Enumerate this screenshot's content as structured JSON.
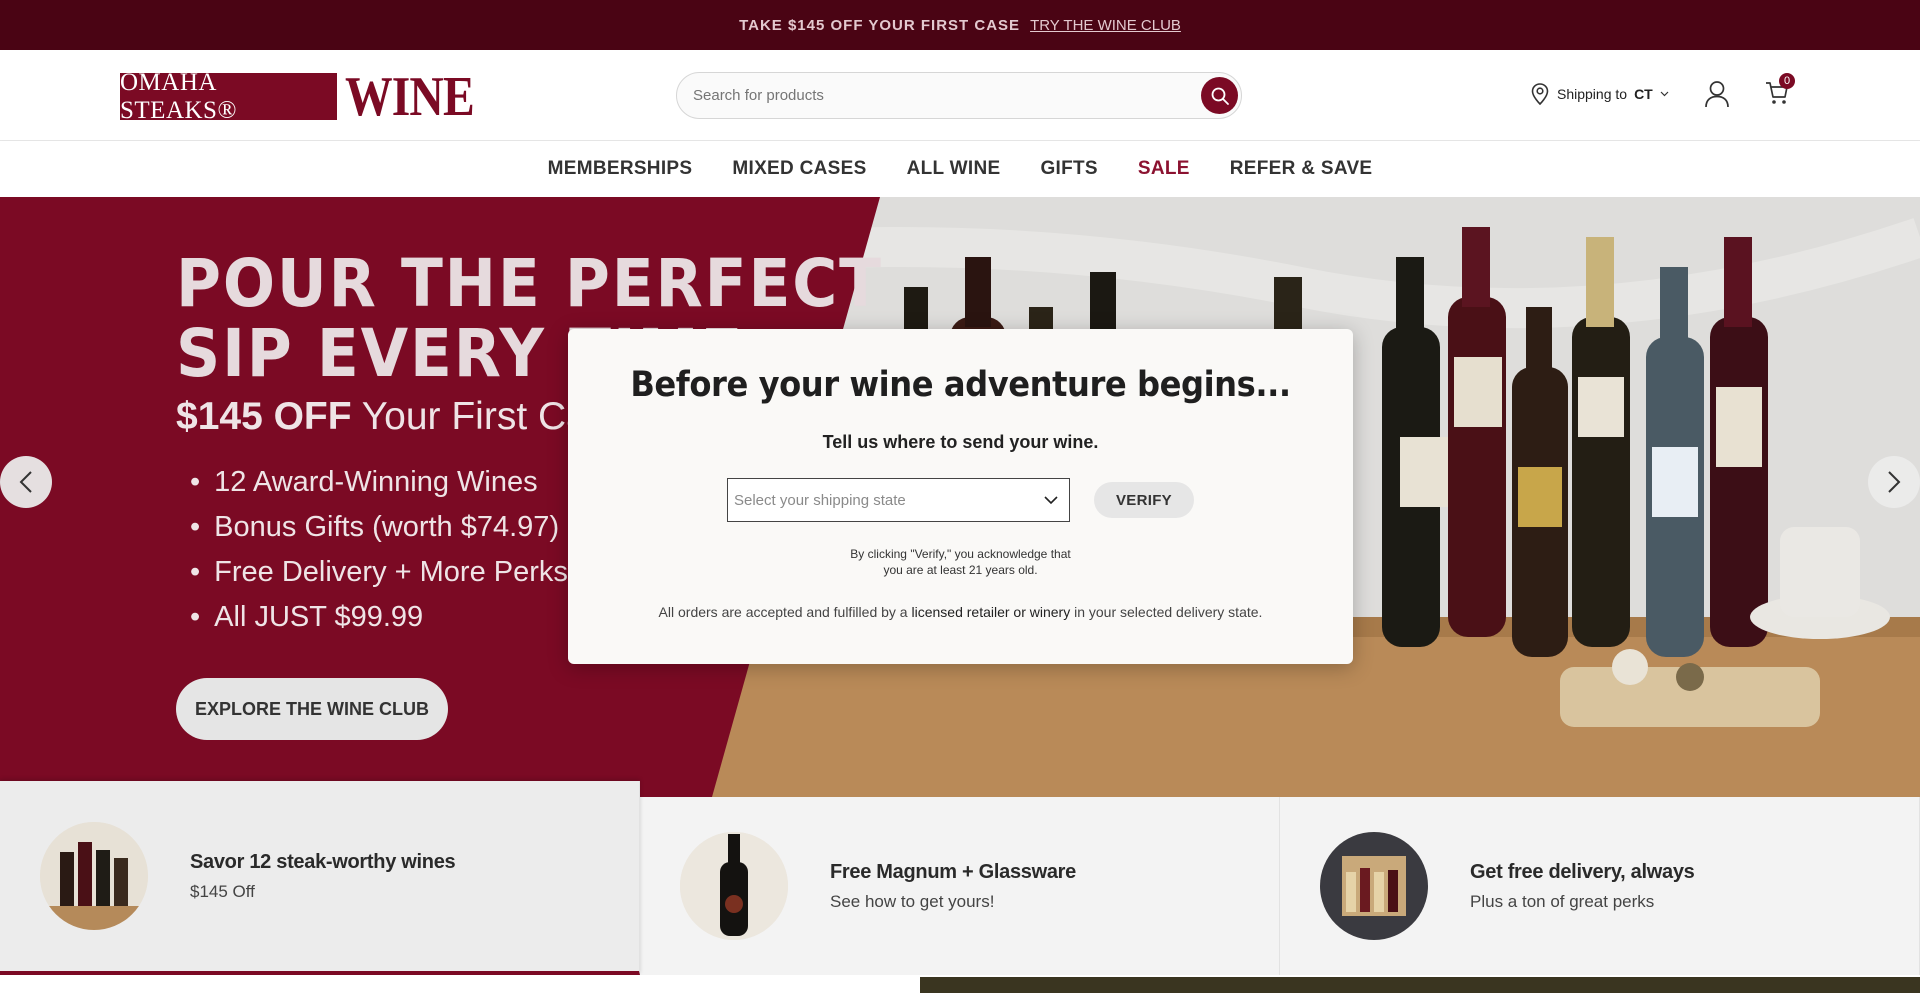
{
  "promo": {
    "text": "TAKE $145 OFF YOUR FIRST CASE",
    "link": "TRY THE WINE CLUB"
  },
  "header": {
    "logo_brand": "OMAHA STEAKS®",
    "logo_wine": "WINE",
    "search_placeholder": "Search for products",
    "shipping_label": "Shipping to",
    "shipping_state": "CT",
    "cart_count": "0"
  },
  "nav": {
    "items": [
      "MEMBERSHIPS",
      "MIXED CASES",
      "ALL WINE",
      "GIFTS",
      "SALE",
      "REFER & SAVE"
    ]
  },
  "hero": {
    "title_line1": "POUR THE PERFECT",
    "title_line2": "SIP EVERY TIME",
    "sub_bold": "$145 OFF",
    "sub_rest": "Your First Case",
    "bullets": [
      "12 Award-Winning Wines",
      "Bonus Gifts (worth $74.97)",
      "Free Delivery + More Perks",
      "All JUST $99.99"
    ],
    "cta": "EXPLORE THE WINE CLUB"
  },
  "features": [
    {
      "title": "Savor 12 steak-worthy wines",
      "sub": "$145 Off"
    },
    {
      "title": "Free Magnum + Glassware",
      "sub": "See how to get yours!"
    },
    {
      "title": "Get free delivery, always",
      "sub": "Plus a ton of great perks"
    }
  ],
  "modal": {
    "title": "Before your wine adventure begins...",
    "subtitle": "Tell us where to send your wine.",
    "select_placeholder": "Select your shipping state",
    "verify": "VERIFY",
    "legal_line1": "By clicking \"Verify,\" you acknowledge that",
    "legal_line2": "you are at least 21 years old.",
    "note_before": "All orders are accepted and fulfilled by a ",
    "note_link": "licensed retailer or winery",
    "note_after": " in your selected delivery state."
  },
  "colors": {
    "brand": "#7b0a24",
    "promo_bg": "#4a0414",
    "sale": "#8b1230"
  }
}
